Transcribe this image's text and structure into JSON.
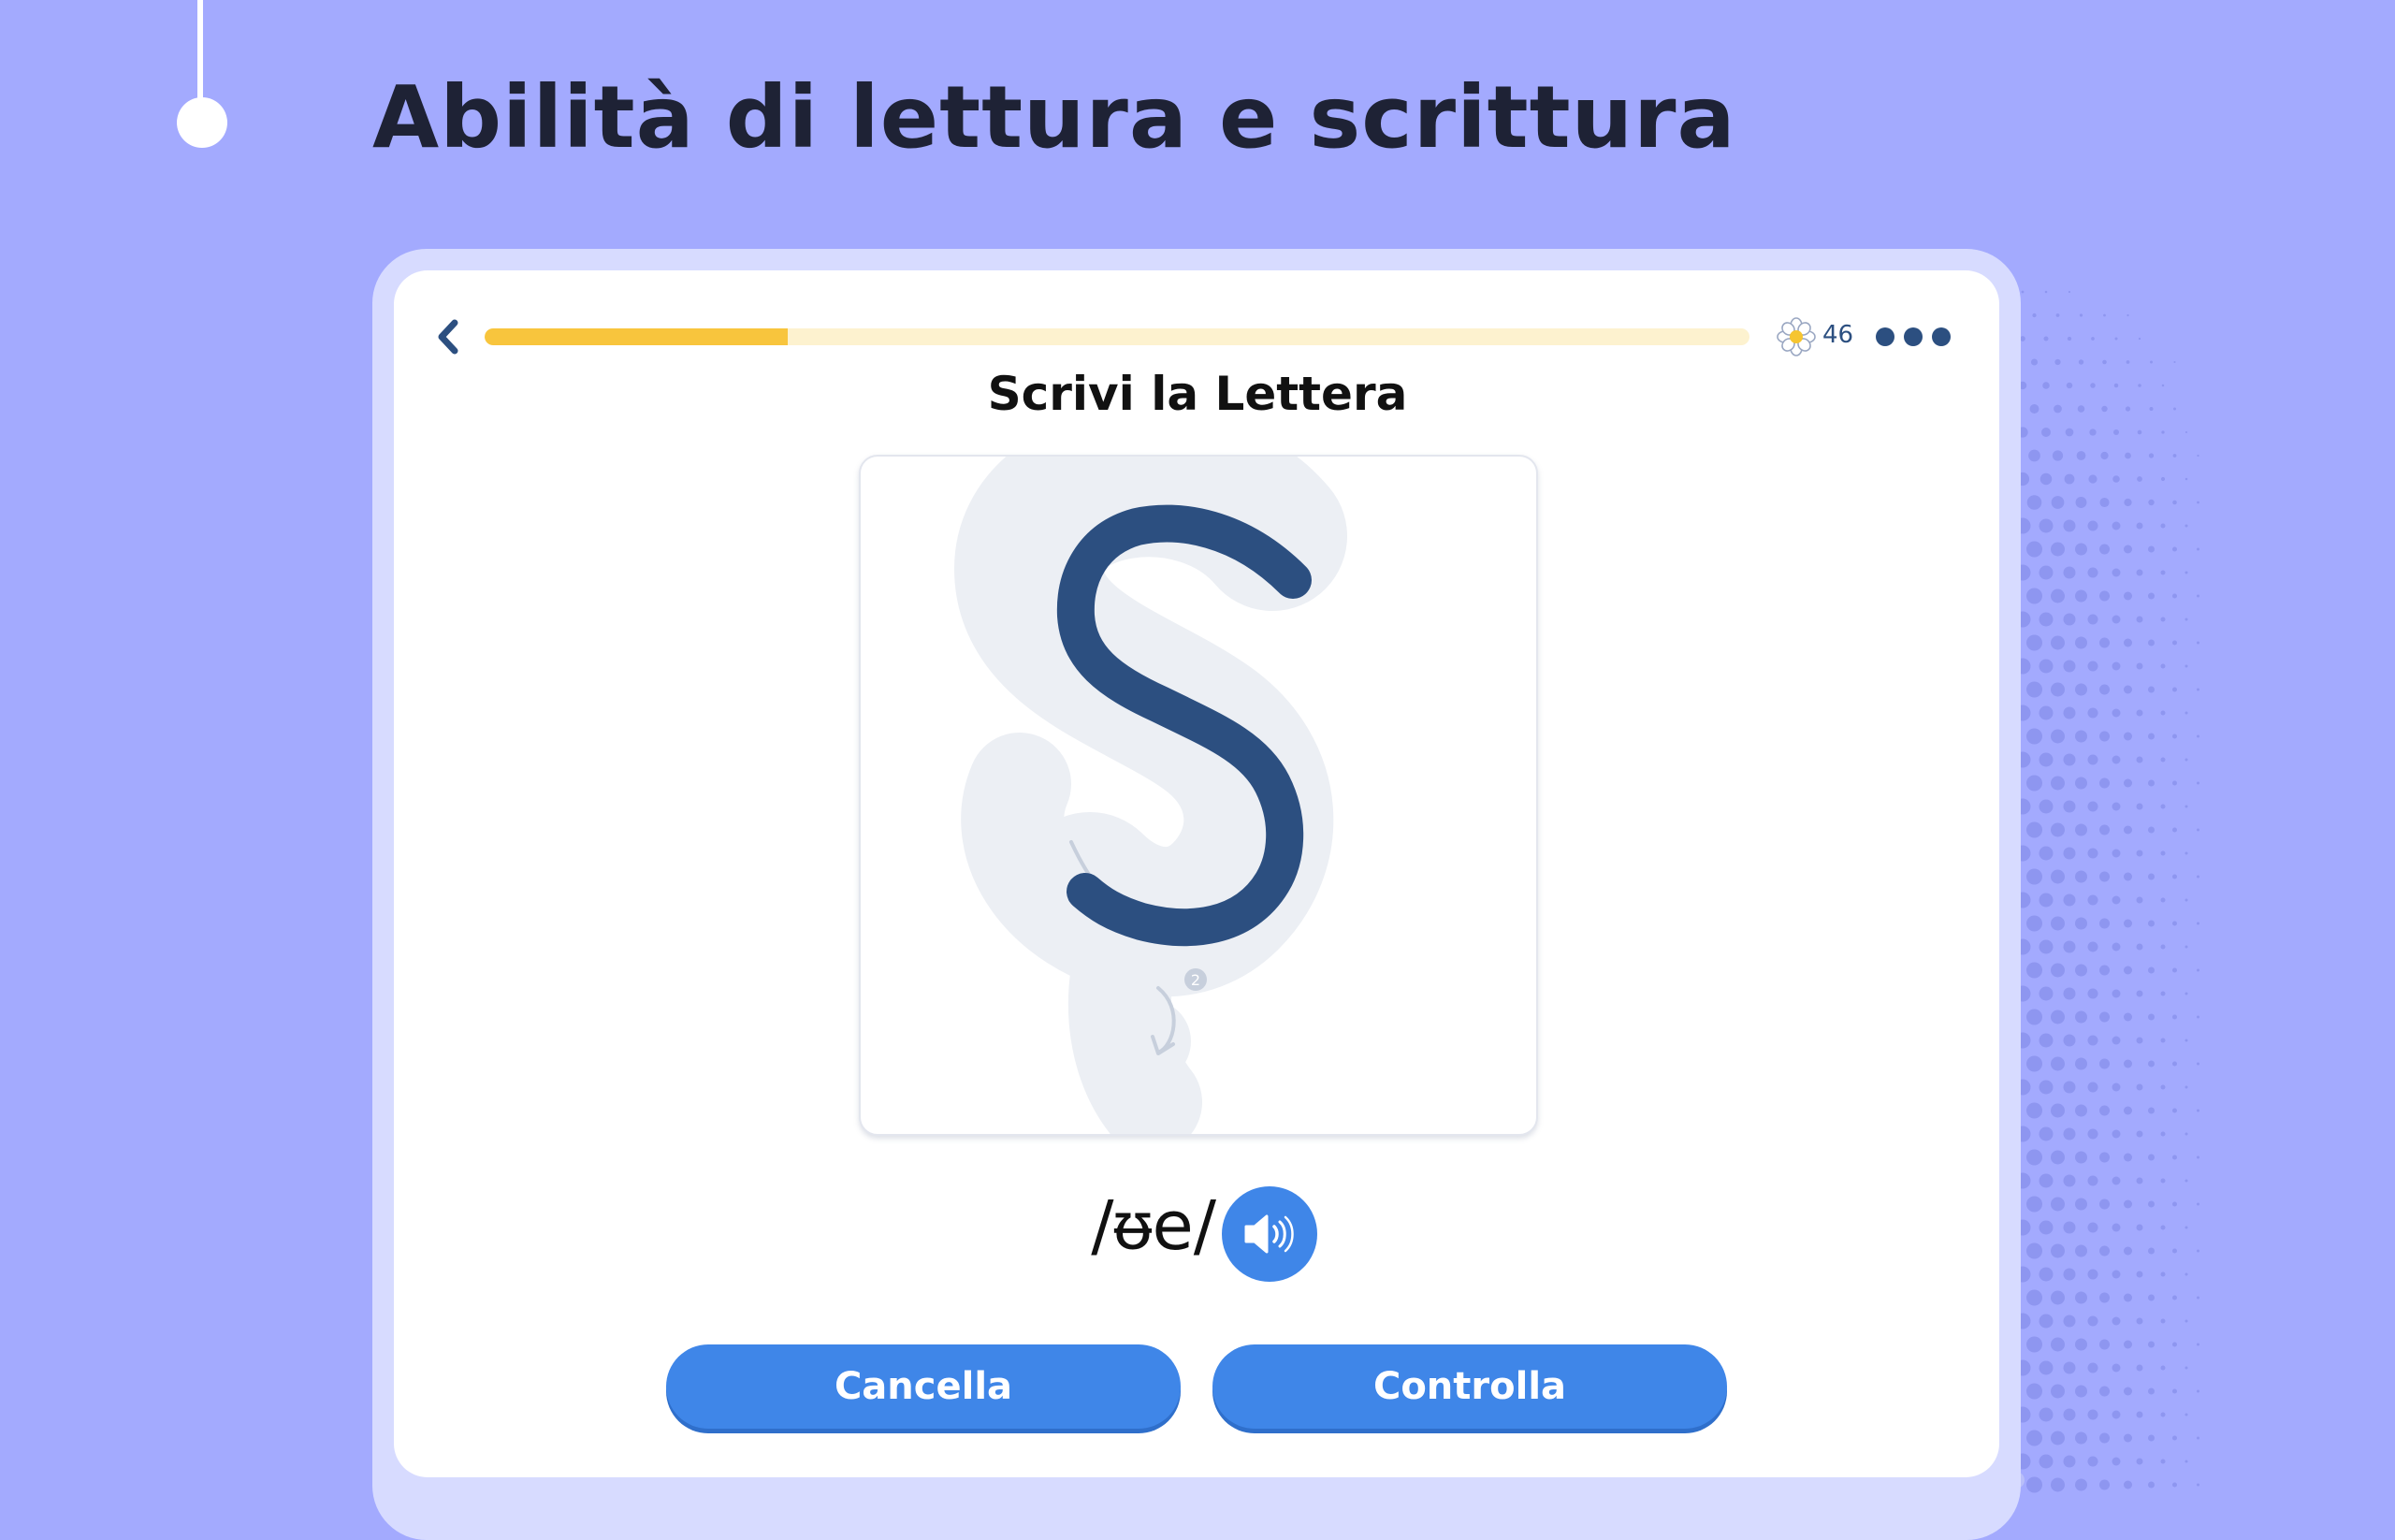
{
  "headline": "Abilità di lettura e scrittura",
  "app": {
    "exercise_title": "Scrivi la Lettera",
    "progress_fraction": 0.24,
    "score": "46",
    "icons": {
      "back": "chevron-left-icon",
      "score": "flower-icon",
      "more": "more-dots-icon",
      "sound": "speaker-icon"
    },
    "letter": {
      "character": "S",
      "stroke_number": "2"
    },
    "phonetic": "/ᵿe/",
    "buttons": {
      "clear_label": "Cancella",
      "check_label": "Controlla"
    }
  },
  "colors": {
    "background": "#a3aafe",
    "accent_blue": "#3f86e8",
    "progress_yellow": "#f8c53d",
    "letter_stroke": "#2c4f80"
  }
}
